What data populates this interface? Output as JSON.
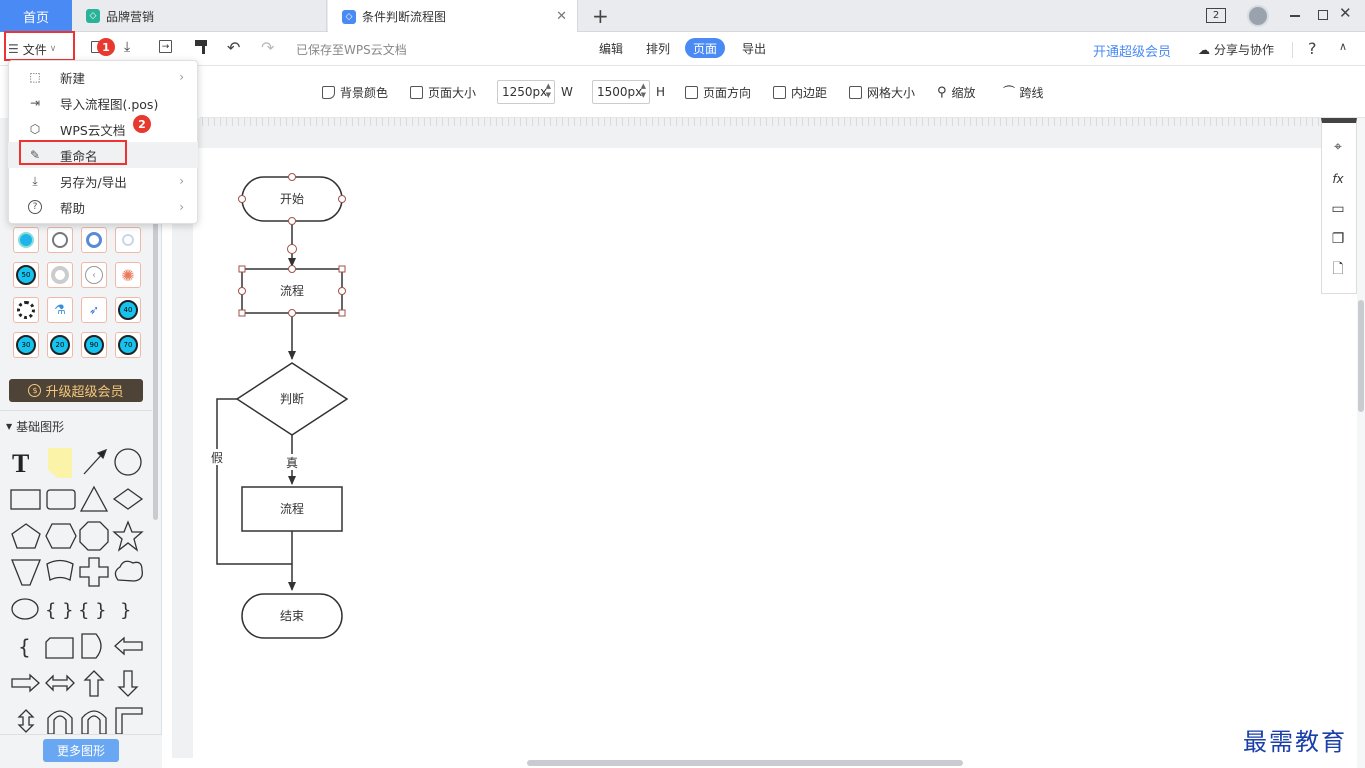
{
  "tabs": {
    "home": "首页",
    "tab1": "品牌营销",
    "tab2": "条件判断流程图",
    "new_tab": "+",
    "window_count": "2"
  },
  "toolbar": {
    "file_label": "文件",
    "saved_status": "已保存至WPS云文档",
    "modes": [
      "编辑",
      "排列",
      "页面",
      "导出"
    ],
    "active_mode": "页面",
    "vip_link": "开通超级会员",
    "share_label": "分享与协作",
    "help": "?"
  },
  "ribbon": {
    "bg_color": "背景颜色",
    "page_size": "页面大小",
    "width_value": "1250px",
    "width_unit": "W",
    "height_value": "1500px",
    "height_unit": "H",
    "orientation": "页面方向",
    "padding": "内边距",
    "grid_size": "网格大小",
    "zoom": "缩放",
    "jumpline": "跨线"
  },
  "file_menu": {
    "items": [
      {
        "label": "新建",
        "icon": "new-file-icon",
        "submenu": true
      },
      {
        "label": "导入流程图(.pos)",
        "icon": "import-icon",
        "submenu": false
      },
      {
        "label": "WPS云文档",
        "icon": "cloud-box-icon",
        "submenu": false
      },
      {
        "label": "重命名",
        "icon": "pencil-icon",
        "submenu": false
      },
      {
        "label": "另存为/导出",
        "icon": "download-icon",
        "submenu": true
      },
      {
        "label": "帮助",
        "icon": "help-circle-icon",
        "submenu": true
      }
    ]
  },
  "steps": {
    "one": "1",
    "two": "2"
  },
  "sidebar": {
    "dial_labels": [
      "50",
      "40",
      "30",
      "20",
      "90",
      "70"
    ],
    "upgrade_label": "升级超级会员",
    "basic_shapes_title": "基础图形",
    "text_tool": "T",
    "more_shapes": "更多图形"
  },
  "flowchart": {
    "start": "开始",
    "process1": "流程",
    "decision": "判断",
    "true_label": "真",
    "false_label": "假",
    "process2": "流程",
    "end": "结束"
  },
  "watermark": "最需教育",
  "colors": {
    "accent": "#4a8af4",
    "red_mark": "#e33333",
    "vip_bar": "#4d4336",
    "vip_text": "#f5c77e"
  }
}
